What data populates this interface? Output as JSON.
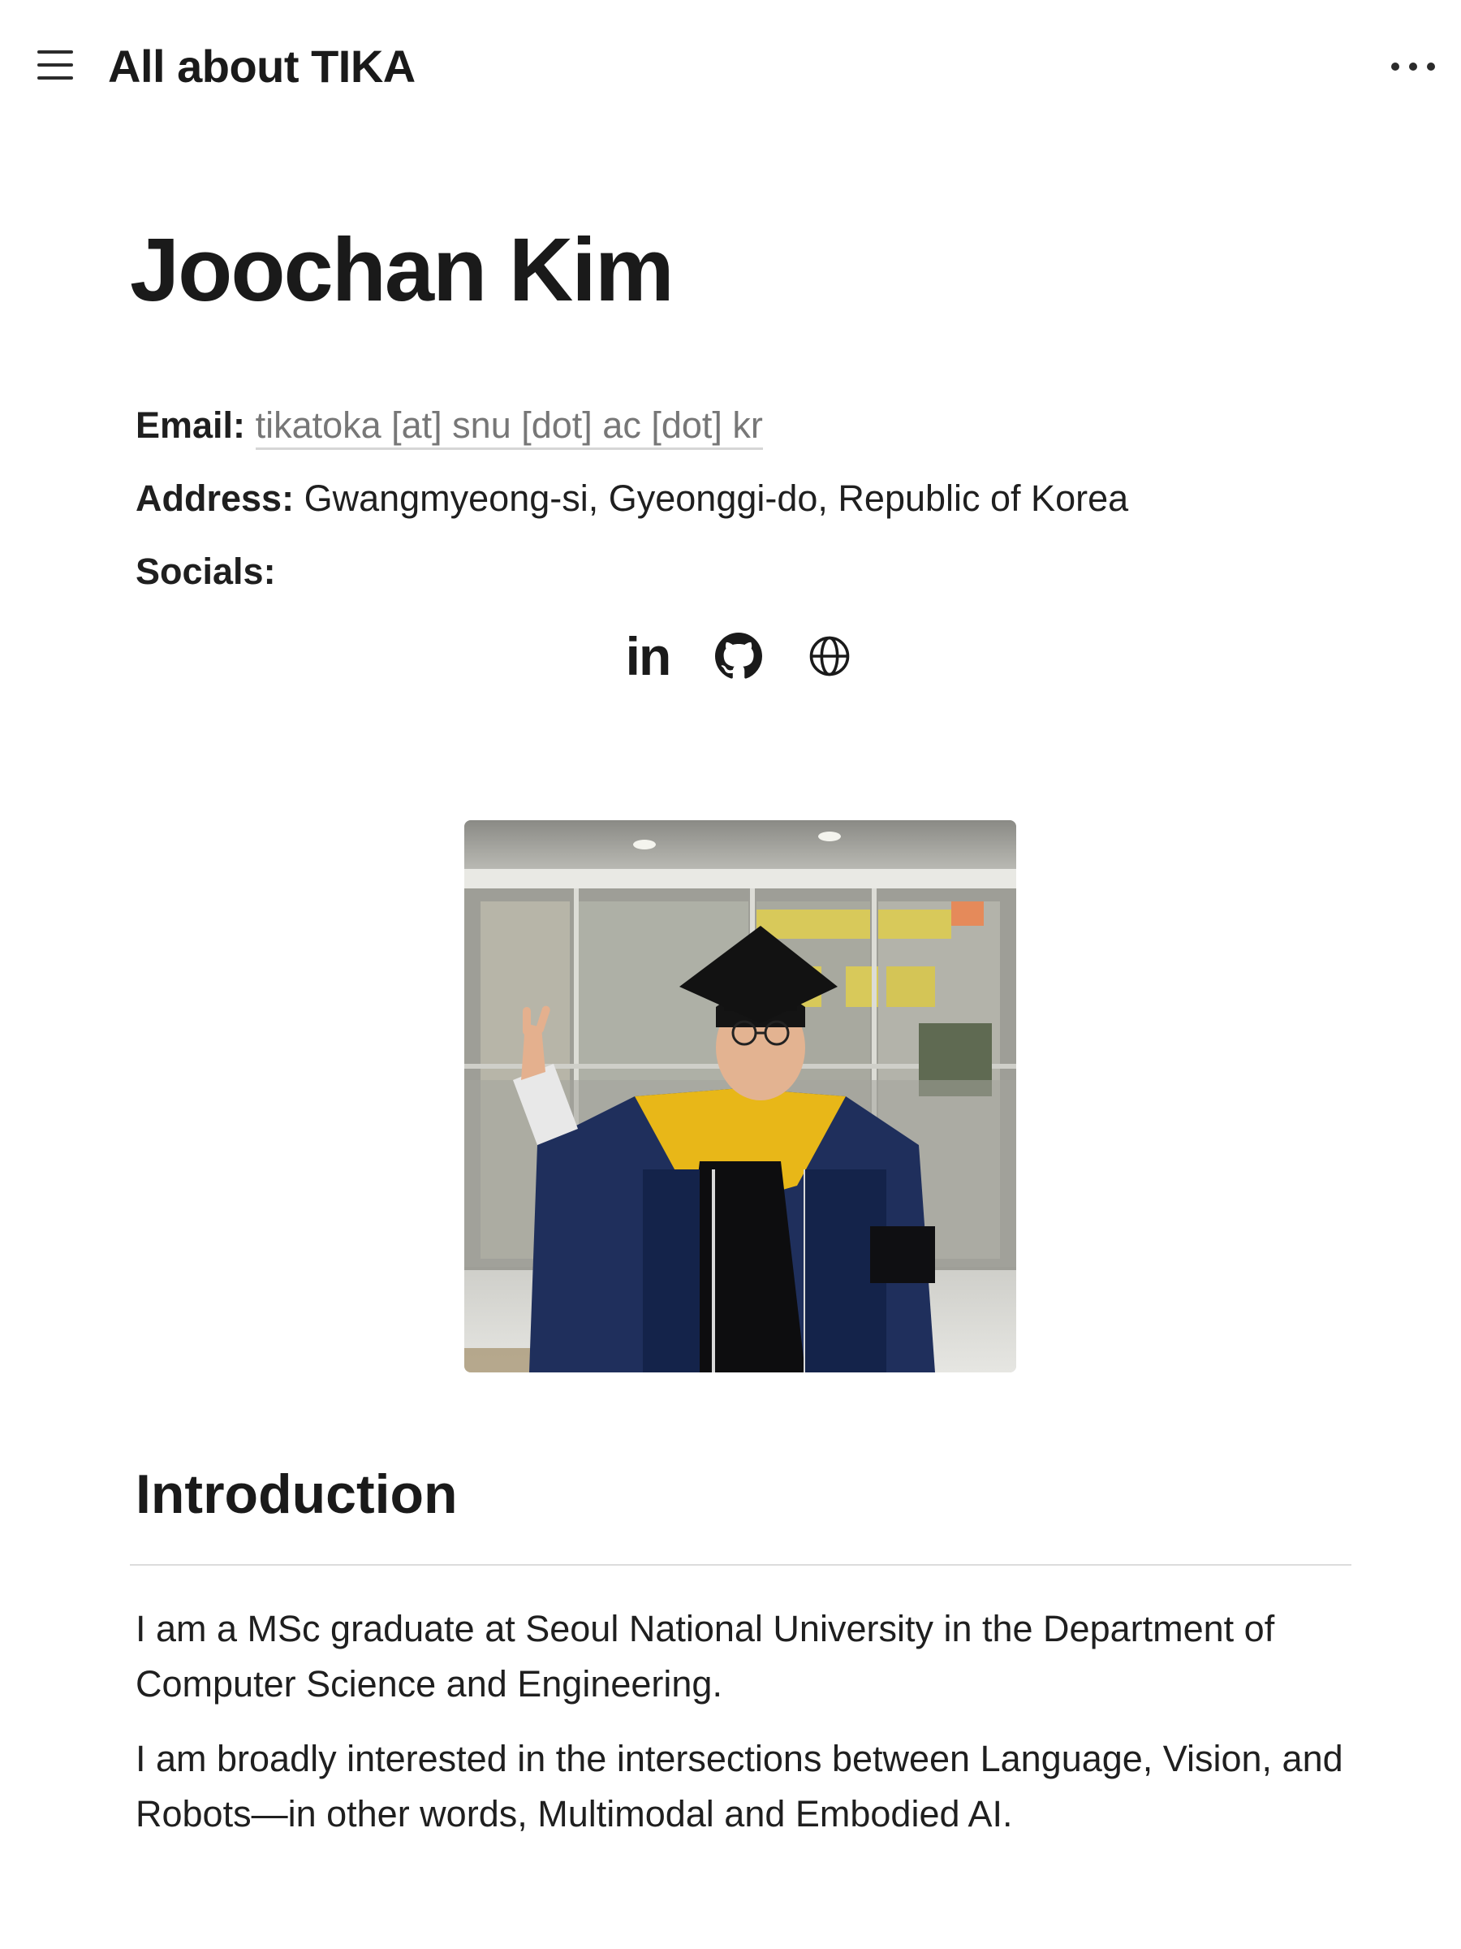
{
  "topbar": {
    "menu_icon": "hamburger-menu-icon",
    "title": "All about TIKA",
    "more_icon": "more-horizontal-icon"
  },
  "page": {
    "heading": "Joochan Kim"
  },
  "contact": {
    "email_label": "Email:",
    "email_value": "tikatoka [at] snu [dot] ac [dot] kr",
    "address_label": "Address:",
    "address_value": "Gwangmyeong-si, Gyeonggi-do, Republic of Korea",
    "socials_label": "Socials:"
  },
  "socials": {
    "linkedin_text": "in",
    "linkedin_icon": "linkedin-icon",
    "github_icon": "github-icon",
    "website_icon": "globe-icon"
  },
  "photo": {
    "subject": "profile-photo"
  },
  "introduction": {
    "heading": "Introduction",
    "paragraphs": [
      "I am a MSc graduate at Seoul National University in the Department of Computer Science and Engineering.",
      "I am broadly interested in the intersections between Language, Vision, and Robots—in other words, Multimodal and Embodied AI."
    ]
  },
  "colors": {
    "text": "#1f1f1f",
    "muted_link": "#777777",
    "divider": "#dcdcdc",
    "background": "#ffffff"
  }
}
